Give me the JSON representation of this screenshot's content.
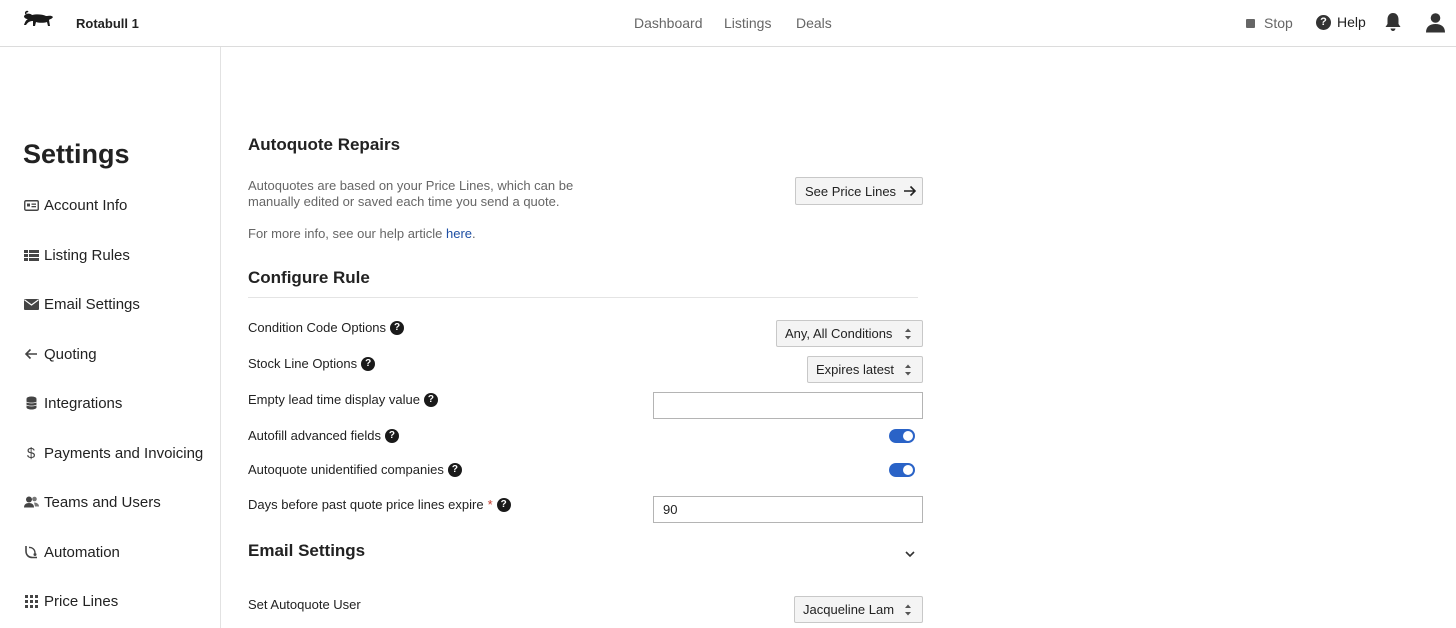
{
  "header": {
    "brand": "Rotabull 1",
    "nav": [
      "Dashboard",
      "Listings",
      "Deals"
    ],
    "stop_label": "Stop",
    "help_label": "Help"
  },
  "sidebar": {
    "title": "Settings",
    "items": [
      {
        "label": "Account Info",
        "icon": "id-card-icon"
      },
      {
        "label": "Listing Rules",
        "icon": "table-icon"
      },
      {
        "label": "Email Settings",
        "icon": "envelope-icon"
      },
      {
        "label": "Quoting",
        "icon": "arrow-left-icon"
      },
      {
        "label": "Integrations",
        "icon": "database-icon"
      },
      {
        "label": "Payments and Invoicing",
        "icon": "dollar-icon"
      },
      {
        "label": "Teams and Users",
        "icon": "users-icon"
      },
      {
        "label": "Automation",
        "icon": "automation-icon"
      },
      {
        "label": "Price Lines",
        "icon": "grid-icon"
      }
    ]
  },
  "main": {
    "autoquote_title": "Autoquote Repairs",
    "autoquote_desc_line1": "Autoquotes are based on your Price Lines, which can be",
    "autoquote_desc_line2": "manually edited or saved each time you send a quote.",
    "help_text_prefix": "For more info, see our help article ",
    "help_link": "here",
    "help_text_suffix": ".",
    "see_price_lines_button": "See Price Lines",
    "configure_title": "Configure Rule",
    "fields": {
      "condition_code_label": "Condition Code Options",
      "condition_code_value": "Any, All Conditions",
      "stock_line_label": "Stock Line Options",
      "stock_line_value": "Expires latest",
      "empty_lead_label": "Empty lead time display value",
      "empty_lead_value": "",
      "autofill_label": "Autofill advanced fields",
      "autofill_on": true,
      "unidentified_label": "Autoquote unidentified companies",
      "unidentified_on": true,
      "days_expire_label": "Days before past quote price lines expire",
      "days_expire_required": "*",
      "days_expire_value": "90"
    },
    "email_settings_title": "Email Settings",
    "autoquote_user_label": "Set Autoquote User",
    "autoquote_user_value": "Jacqueline Lam"
  },
  "colors": {
    "accent": "#2a63c7",
    "link": "#1e4fa3",
    "required": "#c0392b"
  }
}
